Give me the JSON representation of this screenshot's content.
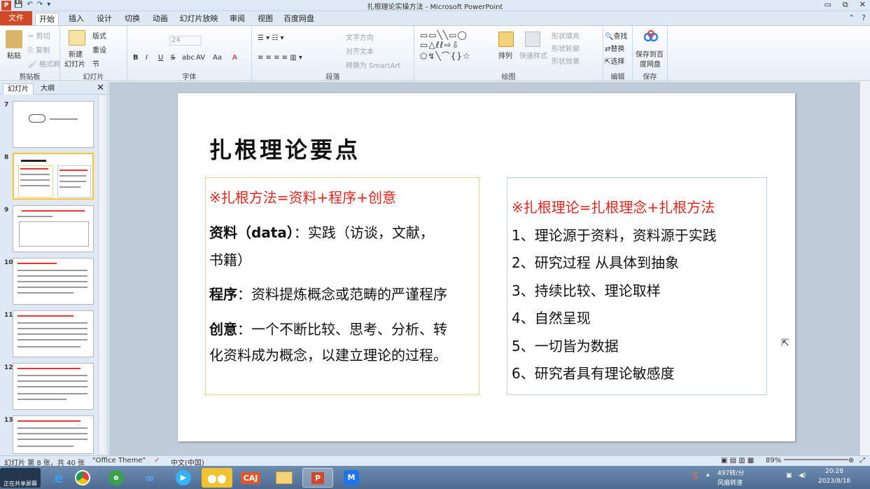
{
  "window": {
    "title": "扎根理论实操方法 - Microsoft PowerPoint",
    "controls": [
      "▭",
      "⧉",
      "✕"
    ]
  },
  "tabs": [
    "文件",
    "开始",
    "插入",
    "设计",
    "切换",
    "动画",
    "幻灯片放映",
    "审阅",
    "视图",
    "百度网盘"
  ],
  "active_tab": "开始",
  "ribbon": {
    "clipboard": {
      "paste": "粘贴",
      "cut": "剪切",
      "copy": "复制",
      "format_painter": "格式刷",
      "label": "剪贴板"
    },
    "slides": {
      "new_slide": "新建",
      "new_slide2": "幻灯片",
      "layout": "版式",
      "reset": "重设",
      "section": "节",
      "label": "幻灯片"
    },
    "font": {
      "size": "24",
      "bold": "B",
      "italic": "I",
      "underline": "U",
      "strike": "S",
      "shadow": "abc",
      "spacing": "AV",
      "case": "Aa",
      "color": "A",
      "label": "字体"
    },
    "paragraph": {
      "text_direction": "文字方向",
      "align_text": "对齐文本",
      "smartart": "转换为 SmartArt",
      "label": "段落"
    },
    "drawing": {
      "arrange": "排列",
      "quick_styles": "快速样式",
      "fill": "形状填充",
      "outline": "形状轮廓",
      "effects": "形状效果",
      "label": "绘图"
    },
    "editing": {
      "find": "查找",
      "replace": "替换",
      "select": "选择",
      "label": "编辑"
    },
    "save": {
      "save_to": "保存到百",
      "save_to2": "度网盘",
      "label": "保存"
    }
  },
  "left_panel": {
    "tabs": [
      "幻灯片",
      "大纲"
    ],
    "close": "✕",
    "thumbnails": [
      "7",
      "8",
      "9",
      "10",
      "11",
      "12",
      "13"
    ],
    "selected": "8"
  },
  "slide": {
    "title": "扎根理论要点",
    "box1": {
      "heading": "※扎根方法=资料+程序+创意",
      "line1_bold": "资料（data）",
      "line1_rest": "：实践（访谈，文献，",
      "line1_cont": "书籍）",
      "line2_bold": "程序",
      "line2_rest": "：资料提炼概念或范畴的严谨程序",
      "line3_bold": "创意",
      "line3_rest": "：一个不断比较、思考、分析、转",
      "line3_cont": "化资料成为概念，以建立理论的过程。"
    },
    "box2": {
      "heading": "※扎根理论=扎根理念+扎根方法",
      "items": [
        "1、理论源于资料，资料源于实践",
        "2、研究过程 从具体到抽象",
        "3、持续比较、理论取样",
        "4、自然呈现",
        "5、一切皆为数据",
        "6、研究者具有理论敏感度"
      ]
    }
  },
  "statusbar": {
    "slide_info": "幻灯片 第 8 张，共 40 张",
    "theme": "\"Office Theme\"",
    "lang": "中文(中国)",
    "zoom": "89%"
  },
  "taskbar": {
    "apps": [
      "CAJ"
    ],
    "tray_speed": "497转/分",
    "tray_label": "风扇转速",
    "time": "20:28",
    "date": "2023/8/18",
    "share_label": "正在共享屏幕"
  },
  "colors": {
    "accent": "#d24726",
    "red_text": "#e8231b",
    "box1_border": "#f1d57c",
    "box2_border": "#bcd0e6"
  }
}
